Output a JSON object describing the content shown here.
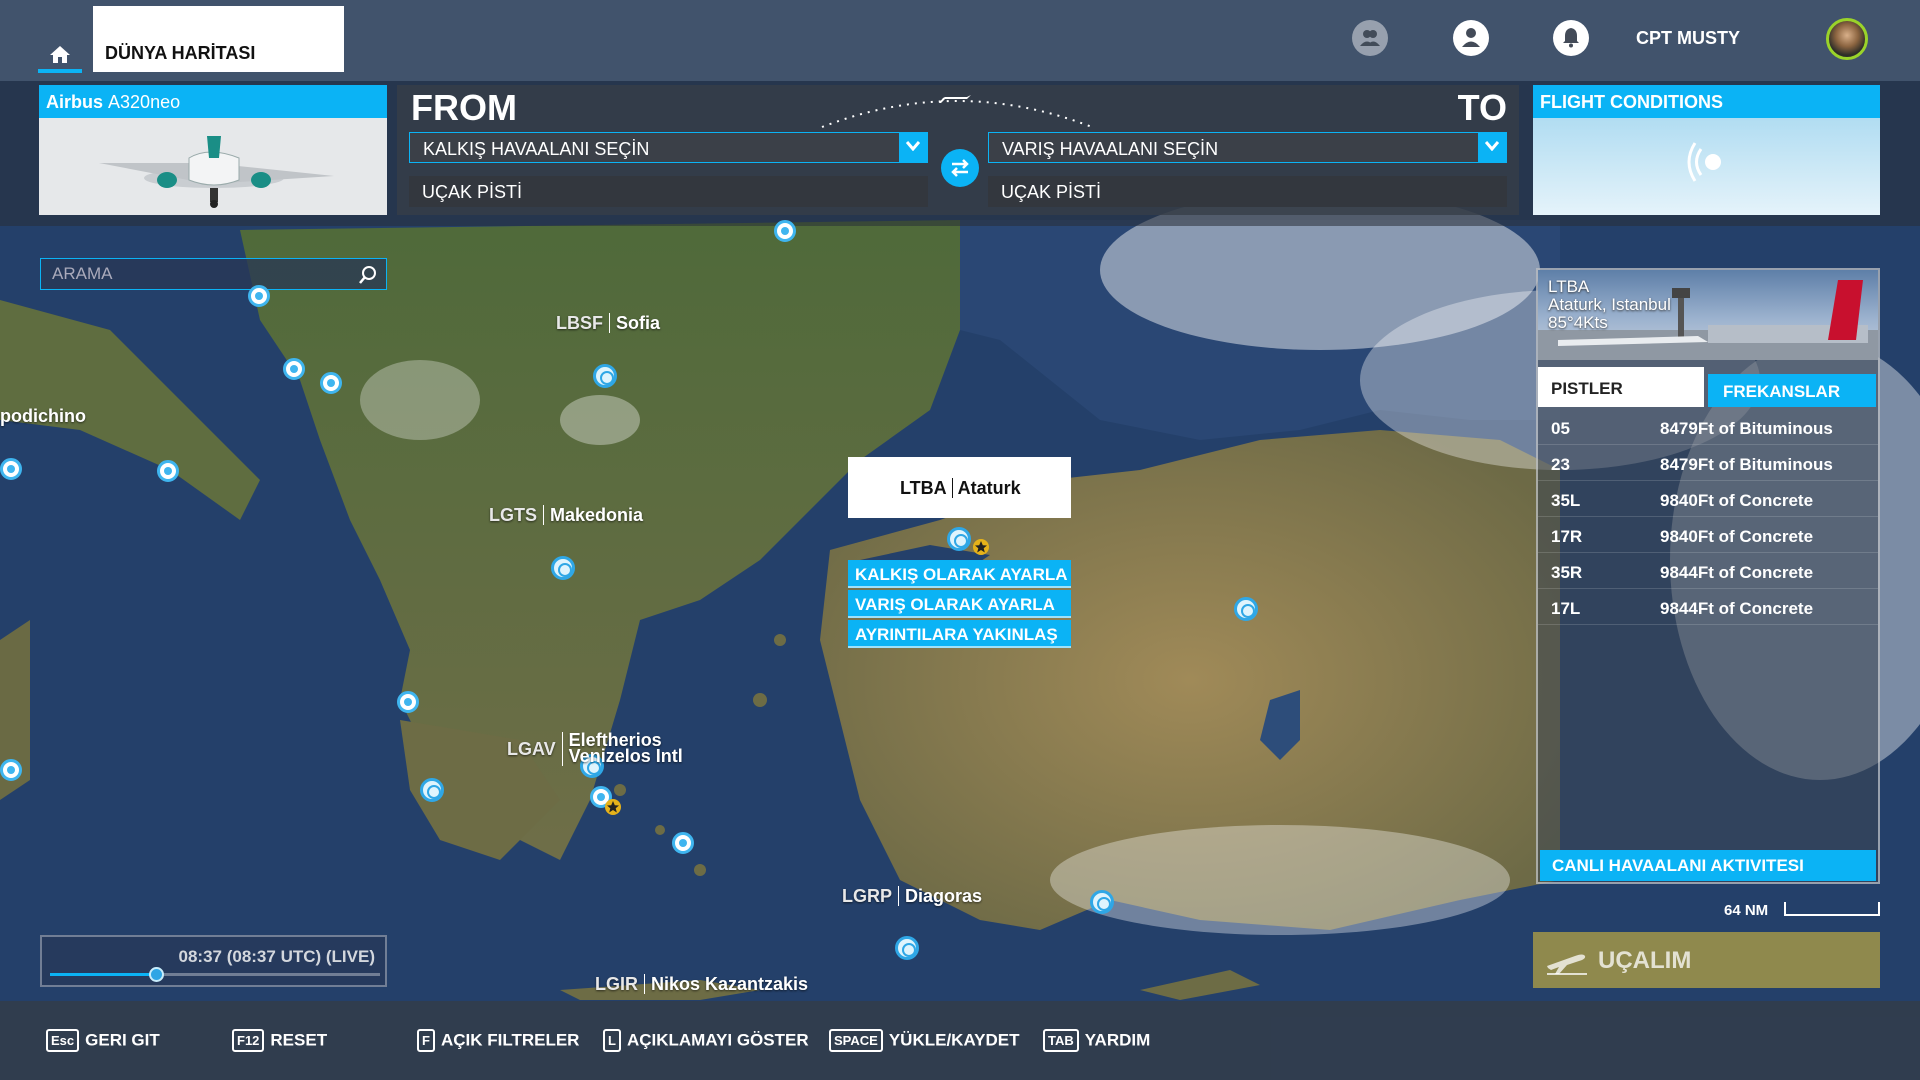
{
  "topbar": {
    "home_icon": "home-icon",
    "world_map_tab": "DÜNYA HARİTASI",
    "friends_icon": "friends-icon",
    "profile_icon": "profile-icon",
    "notifications_icon": "bell-icon",
    "username": "CPT MUSTY"
  },
  "aircraft": {
    "brand": "Airbus",
    "model": "A320neo"
  },
  "route": {
    "from_label": "FROM",
    "to_label": "TO",
    "departure_placeholder": "KALKIŞ HAVAALANI SEÇİN",
    "departure_runway": "UÇAK PİSTİ",
    "arrival_placeholder": "VARIŞ HAVAALANI SEÇİN",
    "arrival_runway": "UÇAK PİSTİ",
    "swap_icon": "swap-icon"
  },
  "conditions": {
    "title": "FLIGHT CONDITIONS",
    "icon": "weather-live-icon"
  },
  "search": {
    "placeholder": "ARAMA",
    "icon": "search-icon"
  },
  "map_labels": [
    {
      "code": "LBSF",
      "name": "Sofia"
    },
    {
      "code": "LGTS",
      "name": "Makedonia"
    },
    {
      "code": "LGAV",
      "name": "Eleftherios Venizelos Intl"
    },
    {
      "code": "LGRP",
      "name": "Diagoras"
    },
    {
      "code": "LGIR",
      "name": "Nikos Kazantzakis"
    },
    {
      "code": "",
      "name": "podichino"
    }
  ],
  "context_menu": {
    "code": "LTBA",
    "name": "Ataturk",
    "set_departure": "KALKIŞ OLARAK AYARLA",
    "set_arrival": "VARIŞ OLARAK AYARLA",
    "zoom_details": "AYRINTILARA YAKINLAŞ"
  },
  "airport_card": {
    "code": "LTBA",
    "name": "Ataturk, Istanbul",
    "wind": "85°4Kts",
    "tab_runways": "PISTLER",
    "tab_frequencies": "FREKANSLAR",
    "runways": [
      {
        "id": "05",
        "desc": "8479Ft of Bituminous"
      },
      {
        "id": "23",
        "desc": "8479Ft of Bituminous"
      },
      {
        "id": "35L",
        "desc": "9840Ft of Concrete"
      },
      {
        "id": "17R",
        "desc": "9840Ft of Concrete"
      },
      {
        "id": "35R",
        "desc": "9844Ft of Concrete"
      },
      {
        "id": "17L",
        "desc": "9844Ft of Concrete"
      }
    ],
    "live_activity": "CANLI HAVAALANI AKTIVITESI"
  },
  "map_scale": "64 NM",
  "fly_button": "UÇALIM",
  "time": {
    "label": "08:37 (08:37 UTC) (LIVE)",
    "slider_fraction": 0.32
  },
  "bottom_hints": [
    {
      "key": "Esc",
      "label": "GERI GIT"
    },
    {
      "key": "F12",
      "label": "RESET"
    },
    {
      "key": "F",
      "label": "AÇIK FILTRELER"
    },
    {
      "key": "L",
      "label": "AÇIKLAMAYI GÖSTER"
    },
    {
      "key": "SPACE",
      "label": "YÜKLE/KAYDET"
    },
    {
      "key": "TAB",
      "label": "YARDIM"
    }
  ],
  "colors": {
    "accent": "#0bb3f5",
    "fly_button": "#e8c434",
    "sea": "#24406a",
    "land": "#8a7a4f"
  }
}
